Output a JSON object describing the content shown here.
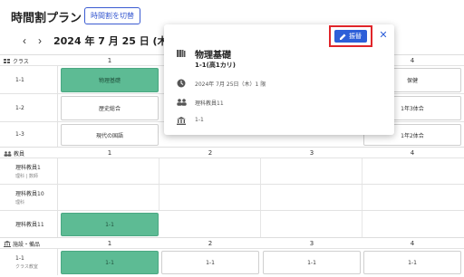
{
  "header": {
    "title": "時間割プラン",
    "switch_label": "時間割を切替"
  },
  "datebar": {
    "date": "2024 年 7 月 25 日 (木曜日)",
    "prev_icon": "chevron-left-icon",
    "next_icon": "chevron-right-icon"
  },
  "periods": [
    "1",
    "2",
    "3",
    "4"
  ],
  "class_section": {
    "label": "クラス",
    "rows": [
      {
        "name": "1-1",
        "cells": [
          "物理基礎",
          "",
          "",
          "保健"
        ]
      },
      {
        "name": "1-2",
        "cells": [
          "歴史総合",
          "",
          "",
          "1年3体合"
        ]
      },
      {
        "name": "1-3",
        "cells": [
          "現代の国語",
          "",
          "",
          "1年2体合"
        ]
      }
    ]
  },
  "teacher_section": {
    "label": "教員",
    "rows": [
      {
        "name": "理科教員1",
        "sub": "理科 | 数師",
        "cells": [
          "",
          "",
          "",
          ""
        ]
      },
      {
        "name": "理科教員10",
        "sub": "理科",
        "cells": [
          "",
          "",
          "",
          ""
        ]
      },
      {
        "name": "理科教員11",
        "sub": "",
        "cells": [
          "1-1",
          "",
          "",
          ""
        ]
      }
    ]
  },
  "room_section": {
    "label": "施設・備品",
    "rows": [
      {
        "name": "1-1",
        "sub": "クラス教室",
        "cells": [
          "1-1",
          "1-1",
          "1-1",
          "1-1"
        ]
      }
    ]
  },
  "popup": {
    "edit_label": "振替",
    "subject": "物理基礎",
    "class_name": "1-1(高1カリ)",
    "datetime": "2024年 7月 25日（木）1 限",
    "teacher": "理科教員11",
    "room": "1-1"
  },
  "colors": {
    "accent": "#2d5fd8",
    "green_cell": "#5dbb94",
    "highlight": "#e0252a"
  }
}
